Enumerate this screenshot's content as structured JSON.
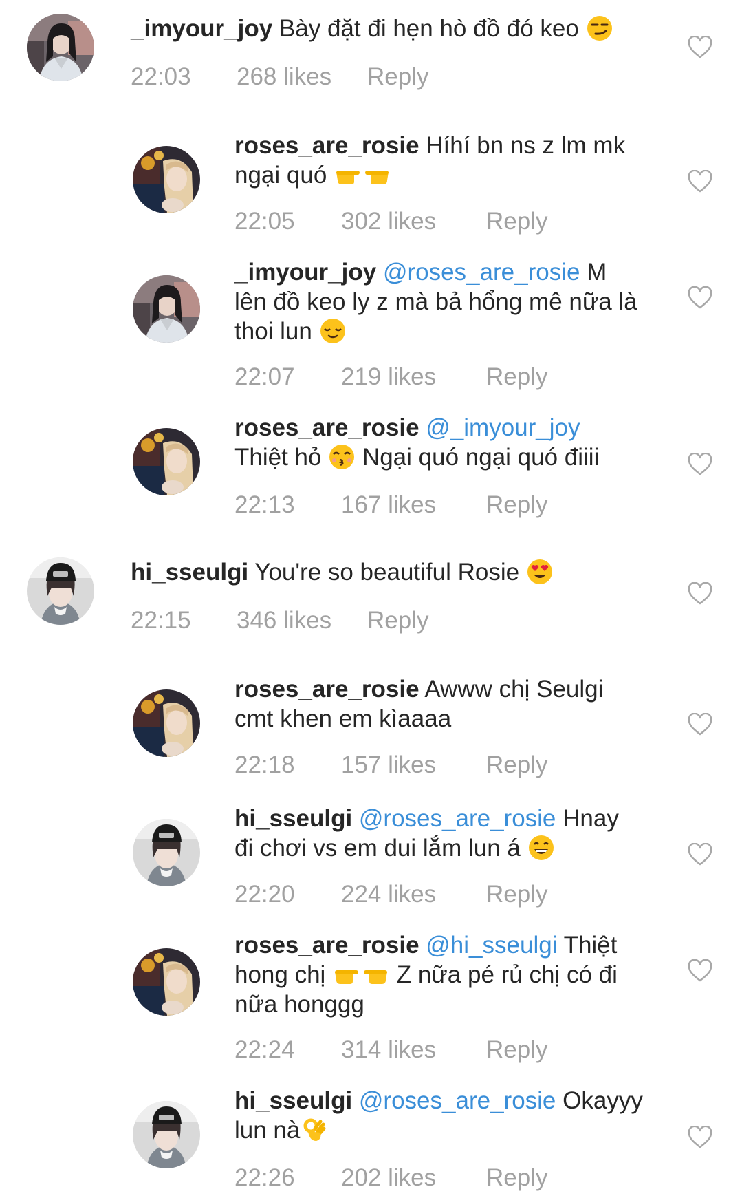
{
  "comments": [
    {
      "user": "_imyour_joy",
      "mention": "",
      "text1": "Bày đặt đi hẹn hò đồ đó keo",
      "line2": "",
      "line3": "",
      "time": "22:03",
      "likes": "268 likes",
      "reply": "Reply",
      "avatar": "joy"
    },
    {
      "user": "roses_are_rosie",
      "mention": "",
      "text1": "Híhí bn ns z lm mk",
      "line2": "ngại quó",
      "line3": "",
      "time": "22:05",
      "likes": "302 likes",
      "reply": "Reply",
      "avatar": "rosie"
    },
    {
      "user": "_imyour_joy",
      "mention": "@roses_are_rosie",
      "text1": "M",
      "line2": "lên đồ keo ly z mà bả hổng mê nữa là",
      "line3": "thoi lun",
      "time": "22:07",
      "likes": "219 likes",
      "reply": "Reply",
      "avatar": "joy"
    },
    {
      "user": "roses_are_rosie",
      "mention": "@_imyour_joy",
      "text1": "",
      "line2": "Thiệt hỏ",
      "line2b": "Ngại quó ngại quó điiii",
      "line3": "",
      "time": "22:13",
      "likes": "167 likes",
      "reply": "Reply",
      "avatar": "rosie"
    },
    {
      "user": "hi_sseulgi",
      "mention": "",
      "text1": "You're so beautiful Rosie",
      "line2": "",
      "line3": "",
      "time": "22:15",
      "likes": "346 likes",
      "reply": "Reply",
      "avatar": "seulgi"
    },
    {
      "user": "roses_are_rosie",
      "mention": "",
      "text1": "Awww chị Seulgi",
      "line2": "cmt khen em kìaaaa",
      "line3": "",
      "time": "22:18",
      "likes": "157 likes",
      "reply": "Reply",
      "avatar": "rosie"
    },
    {
      "user": "hi_sseulgi",
      "mention": "@roses_are_rosie",
      "text1": "Hnay",
      "line2": "đi chơi vs em dui lắm lun á",
      "line3": "",
      "time": "22:20",
      "likes": "224 likes",
      "reply": "Reply",
      "avatar": "seulgi"
    },
    {
      "user": "roses_are_rosie",
      "mention": "@hi_sseulgi",
      "text1": "Thiệt",
      "line2": "hong chị",
      "line2b": "Z nữa pé rủ chị có đi",
      "line3": "nữa honggg",
      "time": "22:24",
      "likes": "314 likes",
      "reply": "Reply",
      "avatar": "rosie"
    },
    {
      "user": "hi_sseulgi",
      "mention": "@roses_are_rosie",
      "text1": "Okayyy",
      "line2": "lun nà",
      "line3": "",
      "time": "22:26",
      "likes": "202 likes",
      "reply": "Reply",
      "avatar": "seulgi"
    }
  ],
  "emojis": {
    "smirk": "smirking-face",
    "point": "pointing-fingers",
    "relieved": "relieved-face",
    "kiss": "kissing-face",
    "hearteyes": "heart-eyes-face",
    "grin": "grinning-face",
    "ok": "ok-hand"
  },
  "colors": {
    "text": "#262626",
    "meta": "#a1a1a1",
    "mention": "#3a8ed8",
    "heart_outline": "#a8a8a8"
  }
}
